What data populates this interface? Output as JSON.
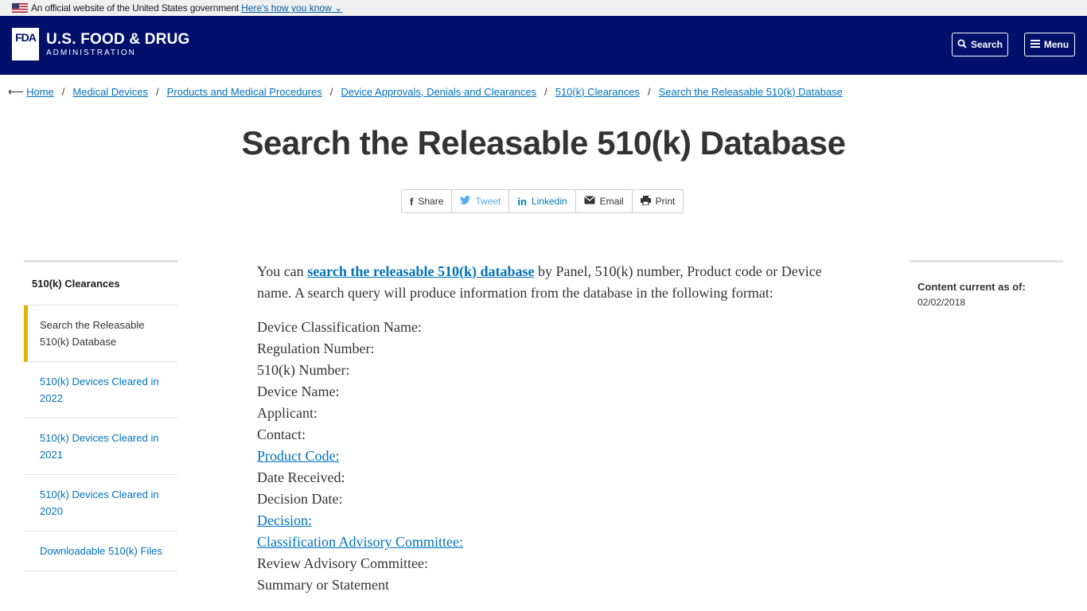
{
  "gov_banner": {
    "text": "An official website of the United States government",
    "link": "Here's how you know"
  },
  "header": {
    "logo_text": "FDA",
    "title": "U.S. FOOD & DRUG",
    "subtitle": "ADMINISTRATION",
    "search_label": "Search",
    "menu_label": "Menu"
  },
  "breadcrumb": [
    "Home",
    "Medical Devices",
    "Products and Medical Procedures",
    "Device Approvals, Denials and Clearances",
    "510(k) Clearances",
    "Search the Releasable 510(k) Database"
  ],
  "page_title": "Search the Releasable 510(k) Database",
  "share": {
    "share": "Share",
    "tweet": "Tweet",
    "linkedin": "Linkedin",
    "email": "Email",
    "print": "Print"
  },
  "sidenav": {
    "heading": "510(k) Clearances",
    "items": [
      "Search the Releasable 510(k) Database",
      "510(k) Devices Cleared in 2022",
      "510(k) Devices Cleared in 2021",
      "510(k) Devices Cleared in 2020",
      "Downloadable 510(k) Files"
    ]
  },
  "content": {
    "intro_prefix": "You can ",
    "intro_link": "search the releasable 510(k) database",
    "intro_suffix": " by Panel, 510(k) number, Product code or Device name. A search query will produce information from the database in the following format:",
    "fields": [
      "Device Classification Name:",
      "Regulation Number:",
      "510(k) Number:",
      "Device Name:",
      "Applicant:",
      "Contact:",
      "Product Code:",
      "Date Received:",
      "Decision Date:",
      "Decision:",
      "Classification Advisory Committee:",
      "Review Advisory Committee:",
      "Summary or Statement"
    ]
  },
  "aside": {
    "label": "Content current as of:",
    "date": "02/02/2018"
  },
  "colors": {
    "header_bg": "#00106b",
    "link": "#0071bc",
    "active_marker": "#e1b400"
  }
}
